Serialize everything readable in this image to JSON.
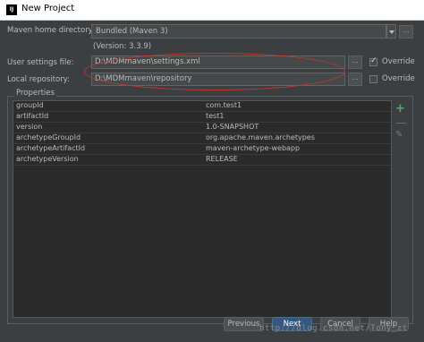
{
  "window": {
    "title": "New Project",
    "app_icon": "IJ"
  },
  "maven_home": {
    "label": "Maven home directory:",
    "value": "Bundled (Maven 3)",
    "version": "(Version: 3.3.9)"
  },
  "user_settings": {
    "label": "User settings file:",
    "value": "D:\\MDMmaven\\settings.xml",
    "override_label": "Override",
    "override_checked": true
  },
  "local_repo": {
    "label": "Local repository:",
    "value": "D:\\MDMmaven\\repository",
    "override_label": "Override",
    "override_checked": false
  },
  "browse_label": "...",
  "properties": {
    "title": "Properties",
    "rows": [
      {
        "key": "groupId",
        "value": "com.test1"
      },
      {
        "key": "artifactId",
        "value": "test1"
      },
      {
        "key": "version",
        "value": "1.0-SNAPSHOT"
      },
      {
        "key": "archetypeGroupId",
        "value": "org.apache.maven.archetypes"
      },
      {
        "key": "archetypeArtifactId",
        "value": "maven-archetype-webapp"
      },
      {
        "key": "archetypeVersion",
        "value": "RELEASE"
      }
    ],
    "add_symbol": "+",
    "remove_symbol": "—",
    "edit_symbol": "✎"
  },
  "buttons": {
    "previous": "Previous",
    "next": "Next",
    "cancel": "Cancel",
    "help": "Help"
  },
  "watermark": "http://blog.csdn.net/Tony_zt",
  "colors": {
    "accent": "#365880",
    "annotation": "#c0392b",
    "add": "#59a869"
  }
}
